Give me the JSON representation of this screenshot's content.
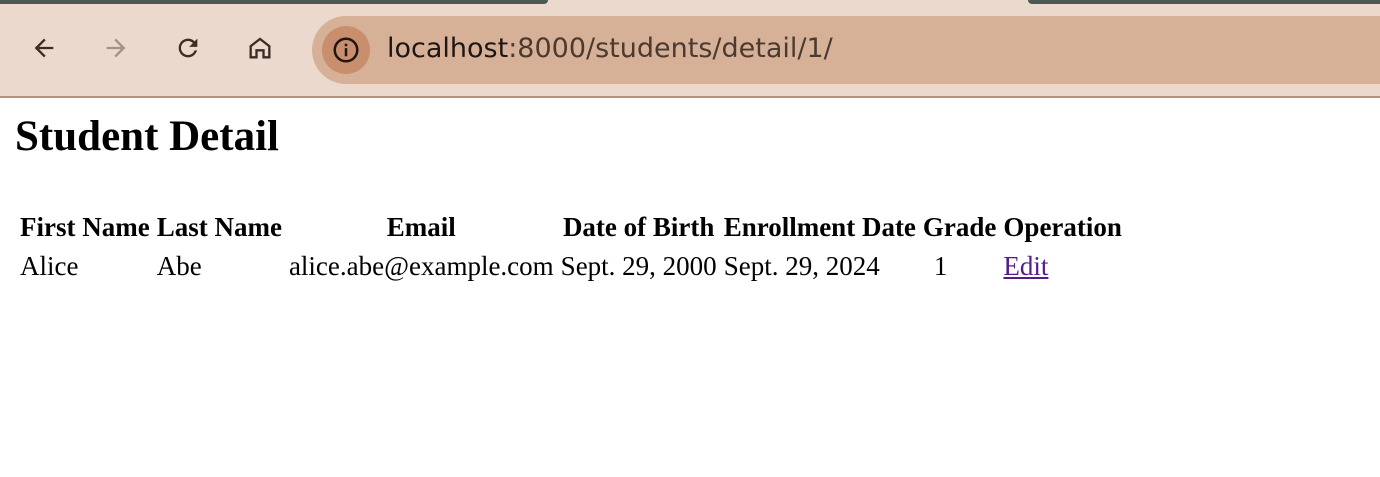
{
  "browser": {
    "url_host": "localhost",
    "url_path": ":8000/students/detail/1/",
    "icons": {
      "back": "arrow-left-icon",
      "forward": "arrow-right-icon",
      "reload": "reload-icon",
      "home": "home-icon",
      "site_info": "info-icon"
    },
    "colors": {
      "toolbar": "#ebd9cd",
      "omnibox": "#d6b197",
      "site_info_bg": "#c88e6e"
    }
  },
  "page": {
    "title": "Student Detail",
    "table": {
      "headers": [
        "First Name",
        "Last Name",
        "Email",
        "Date of Birth",
        "Enrollment Date",
        "Grade",
        "Operation"
      ],
      "row": {
        "first_name": "Alice",
        "last_name": "Abe",
        "email": "alice.abe@example.com",
        "date_of_birth": "Sept. 29, 2000",
        "enrollment_date": "Sept. 29, 2024",
        "grade": "1",
        "operation_link": "Edit"
      }
    },
    "colors": {
      "visited_link": "#551a8b"
    }
  }
}
